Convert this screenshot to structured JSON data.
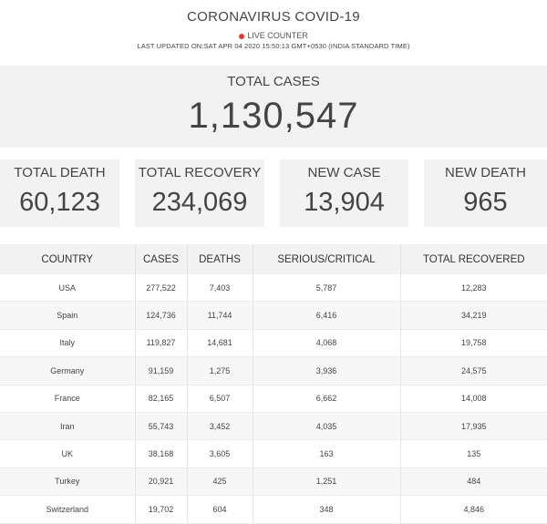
{
  "header": {
    "title": "CORONAVIRUS COVID-19",
    "live_label": "LIVE COUNTER",
    "last_updated": "LAST UPDATED ON:SAT APR 04 2020 15:50:13 GMT+0530 (INDIA STANDARD TIME)"
  },
  "total": {
    "label": "TOTAL CASES",
    "value": "1,130,547"
  },
  "stats": [
    {
      "label": "TOTAL DEATH",
      "value": "60,123"
    },
    {
      "label": "TOTAL RECOVERY",
      "value": "234,069"
    },
    {
      "label": "NEW CASE",
      "value": "13,904"
    },
    {
      "label": "NEW DEATH",
      "value": "965"
    }
  ],
  "table": {
    "headers": [
      "COUNTRY",
      "CASES",
      "DEATHS",
      "SERIOUS/CRITICAL",
      "TOTAL RECOVERED"
    ],
    "rows": [
      [
        "USA",
        "277,522",
        "7,403",
        "5,787",
        "12,283"
      ],
      [
        "Spain",
        "124,736",
        "11,744",
        "6,416",
        "34,219"
      ],
      [
        "Italy",
        "119,827",
        "14,681",
        "4,068",
        "19,758"
      ],
      [
        "Germany",
        "91,159",
        "1,275",
        "3,936",
        "24,575"
      ],
      [
        "France",
        "82,165",
        "6,507",
        "6,662",
        "14,008"
      ],
      [
        "Iran",
        "55,743",
        "3,452",
        "4,035",
        "17,935"
      ],
      [
        "UK",
        "38,168",
        "3,605",
        "163",
        "135"
      ],
      [
        "Turkey",
        "20,921",
        "425",
        "1,251",
        "484"
      ],
      [
        "Switzerland",
        "19,702",
        "604",
        "348",
        "4,846"
      ]
    ]
  },
  "colors": {
    "live_dot": "#e53935",
    "panel_bg": "#f2f2f2",
    "text": "#444444"
  }
}
